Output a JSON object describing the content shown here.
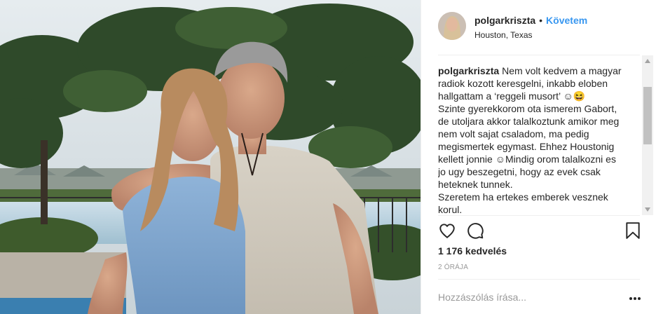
{
  "header": {
    "username": "polgarkriszta",
    "separator": "•",
    "follow_label": "Követem",
    "location": "Houston, Texas"
  },
  "caption": {
    "username": "polgarkriszta",
    "lines": [
      "Nem volt kedvem a magyar",
      "radiok kozott keresgelni, inkabb eloben",
      "hallgattam a ‘reggeli musort’ ☺😆",
      "Szinte gyerekkorom ota ismerem Gabort,",
      "de utoljara akkor talalkoztunk amikor meg",
      "nem volt sajat csaladom, ma pedig",
      "megismertek egymast. Ehhez Houstonig",
      "kellett jonnie ☺Mindig orom talalkozni es",
      "jo ugy beszegetni, hogy az evek csak",
      "heteknek tunnek.",
      "Szeretem ha ertekes emberek vesznek",
      "korul."
    ]
  },
  "actions": {
    "like_icon": "heart-icon",
    "comment_icon": "speech-bubble-icon",
    "save_icon": "bookmark-icon"
  },
  "likes": "1 176 kedvelés",
  "time": "2 ÓRÁJA",
  "comment": {
    "placeholder": "Hozzászólás írása...",
    "more_icon": "ellipsis-icon",
    "more_label": "•••"
  },
  "colors": {
    "accent": "#3897f0",
    "text": "#262626",
    "muted": "#999999",
    "divider": "#efefef"
  }
}
